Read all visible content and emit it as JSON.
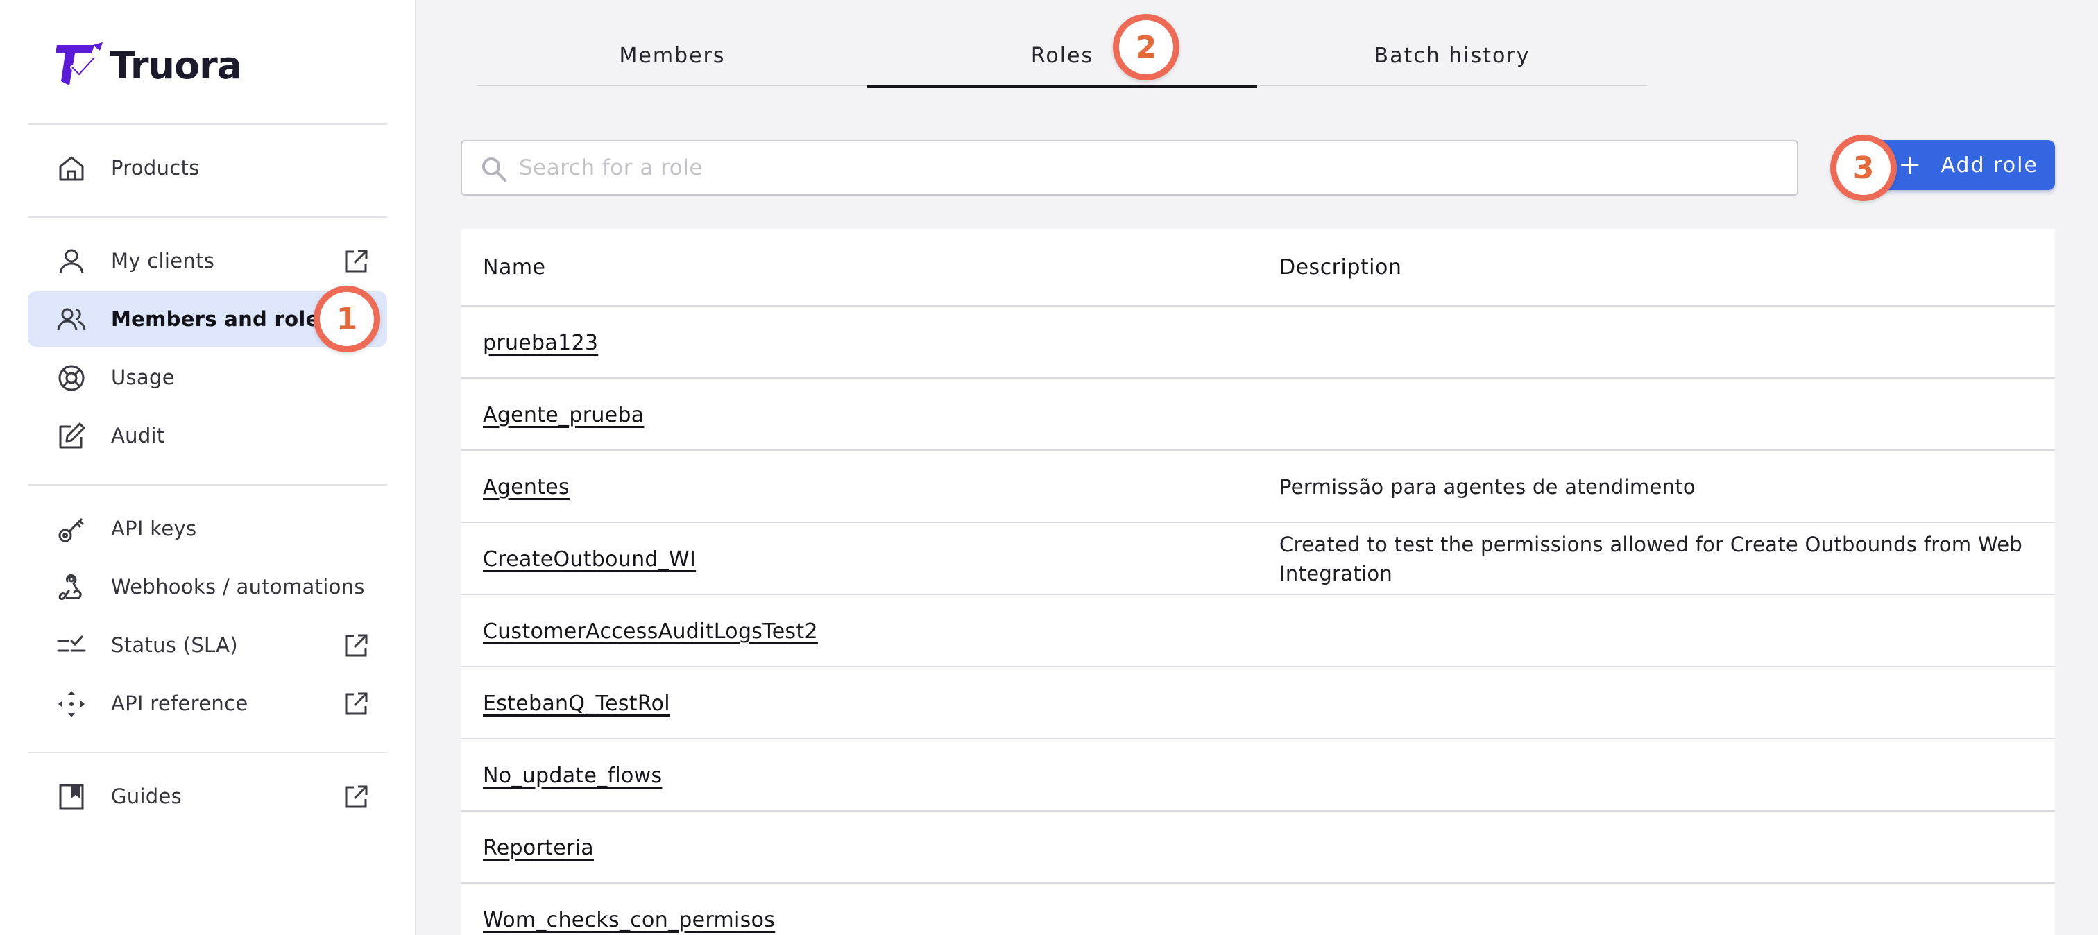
{
  "brand": {
    "name": "Truora",
    "color": "#5b1bd8"
  },
  "sidebar": {
    "items": [
      {
        "label": "Products",
        "icon": "home-icon",
        "external": false,
        "active": false
      },
      {
        "label": "My clients",
        "icon": "user-icon",
        "external": true,
        "active": false
      },
      {
        "label": "Members and roles",
        "icon": "users-icon",
        "external": false,
        "active": true
      },
      {
        "label": "Usage",
        "icon": "lifebuoy-icon",
        "external": false,
        "active": false
      },
      {
        "label": "Audit",
        "icon": "edit-icon",
        "external": false,
        "active": false
      },
      {
        "label": "API keys",
        "icon": "key-icon",
        "external": false,
        "active": false
      },
      {
        "label": "Webhooks / automations",
        "icon": "webhook-icon",
        "external": false,
        "active": false
      },
      {
        "label": "Status (SLA)",
        "icon": "checklist-icon",
        "external": true,
        "active": false
      },
      {
        "label": "API reference",
        "icon": "api-icon",
        "external": true,
        "active": false
      },
      {
        "label": "Guides",
        "icon": "book-icon",
        "external": true,
        "active": false
      }
    ]
  },
  "tabs": [
    {
      "label": "Members",
      "active": false
    },
    {
      "label": "Roles",
      "active": true
    },
    {
      "label": "Batch history",
      "active": false
    }
  ],
  "search": {
    "placeholder": "Search for a role",
    "value": ""
  },
  "add_button": {
    "label": "Add role"
  },
  "table": {
    "columns": [
      "Name",
      "Description"
    ],
    "rows": [
      {
        "name": "prueba123",
        "description": ""
      },
      {
        "name": "Agente_prueba",
        "description": ""
      },
      {
        "name": "Agentes",
        "description": "Permissão para agentes de atendimento"
      },
      {
        "name": "CreateOutbound_WI",
        "description": "Created to test the permissions allowed for Create Outbounds from Web Integration"
      },
      {
        "name": "CustomerAccessAuditLogsTest2",
        "description": ""
      },
      {
        "name": "EstebanQ_TestRol",
        "description": ""
      },
      {
        "name": "No_update_flows",
        "description": ""
      },
      {
        "name": "Reporteria",
        "description": ""
      },
      {
        "name": "Wom_checks_con_permisos",
        "description": ""
      }
    ]
  },
  "badges": [
    "1",
    "2",
    "3"
  ],
  "colors": {
    "accent": "#3466e2",
    "badge_ring": "#ee6a55",
    "active_nav": "#dde6fb"
  }
}
